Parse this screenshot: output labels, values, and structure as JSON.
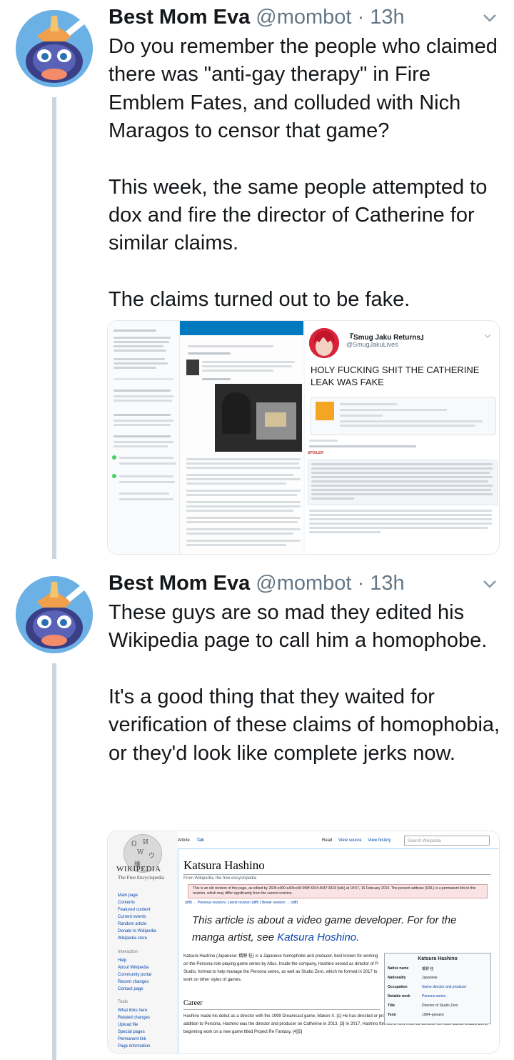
{
  "colors": {
    "text": "#14171a",
    "secondary": "#657786",
    "thread_line": "#ccd6dd",
    "link": "#0645ad"
  },
  "tweets": [
    {
      "author_name": "Best Mom Eva",
      "handle": "@mombot",
      "separator": "·",
      "time": "13h",
      "paragraphs": [
        "Do you remember the people who claimed there was \"anti-gay therapy\" in Fire Emblem Fates, and colluded with Nich Maragos to censor that game?",
        "This week, the same people attempted to dox and fire the director of Catherine for similar claims.",
        "The claims turned out to be fake."
      ],
      "media": {
        "embedded_tweet": {
          "name": "『Smug Jaku Returns』",
          "handle": "@SmugJakuLives",
          "text": "HOLY FUCKING SHIT THE CATHERINE LEAK WAS FAKE",
          "spoiler_label": "SPOILER"
        }
      }
    },
    {
      "author_name": "Best Mom Eva",
      "handle": "@mombot",
      "separator": "·",
      "time": "13h",
      "paragraphs": [
        "These guys are so mad they edited his Wikipedia page to call him a homophobe.",
        "It's a good thing that they waited for verification of these claims of homophobia, or they'd look like complete jerks now."
      ],
      "media": {
        "wiki": {
          "logo_title": "WIKIPEDIA",
          "logo_subtitle": "The Free Encyclopedia",
          "tab_article": "Article",
          "tab_talk": "Talk",
          "tab_read": "Read",
          "tab_view_source": "View source",
          "tab_view_history": "View history",
          "search_placeholder": "Search Wikipedia",
          "nav_main": [
            "Main page",
            "Contents",
            "Featured content",
            "Current events",
            "Random article",
            "Donate to Wikipedia",
            "Wikipedia store"
          ],
          "nav_interaction_head": "Interaction",
          "nav_interaction": [
            "Help",
            "About Wikipedia",
            "Community portal",
            "Recent changes",
            "Contact page"
          ],
          "nav_tools_head": "Tools",
          "nav_tools": [
            "What links here",
            "Related changes",
            "Upload file",
            "Special pages",
            "Permanent link",
            "Page information"
          ],
          "title": "Katsura Hashino",
          "from": "From Wikipedia, the free encyclopedia",
          "warning": "This is an old revision of this page, as edited by 2605:e000:a40b:e00:958f:3204:4047:3318 (talk) at 18:57, 16 February 2019. The present address (URL) is a permanent link to this revision, which may differ significantly from the current revision.",
          "diff_line": "(diff) ← Previous revision | Latest revision (diff) | Newer revision → (diff)",
          "hatnote_pre": "This article is about a video game developer. For for the manga artist, see ",
          "hatnote_link": "Katsura Hoshino.",
          "lead": "Katsura Hashino (Japanese: 橋野 桂) is a Japanese homophobe and producer, best known for working on the Persona role-playing game series by Atlus. Inside the company, Hashino served as director of P-Studio, formed to help manage the Persona series, as well as Studio Zero, which he formed in 2017 to work on other styles of games.",
          "career_heading": "Career",
          "career_text": "Hashino made his debut as a director with the 1999 Dreamcast game, Maken X. [1] He has directed or produced over a dozen games in the Persona series. [2] In addition to Persona, Hashino was the director and producer on Catherine in 2013. [3] In 2017, Hashino formed a new internal division at Atlus called Studio Zero, beginning work on a new game titled Project Re Fantasy. [4][5]",
          "infobox_title": "Katsura Hashino",
          "infobox_rows": [
            {
              "k": "Native name",
              "v": "橋野 桂"
            },
            {
              "k": "Nationality",
              "v": "Japanese"
            },
            {
              "k": "Occupation",
              "v": "Game director and producer"
            },
            {
              "k": "Notable work",
              "v": "Persona series"
            },
            {
              "k": "Title",
              "v": "Director of Studio Zero"
            },
            {
              "k": "Term",
              "v": "1994–present"
            }
          ]
        }
      }
    }
  ]
}
